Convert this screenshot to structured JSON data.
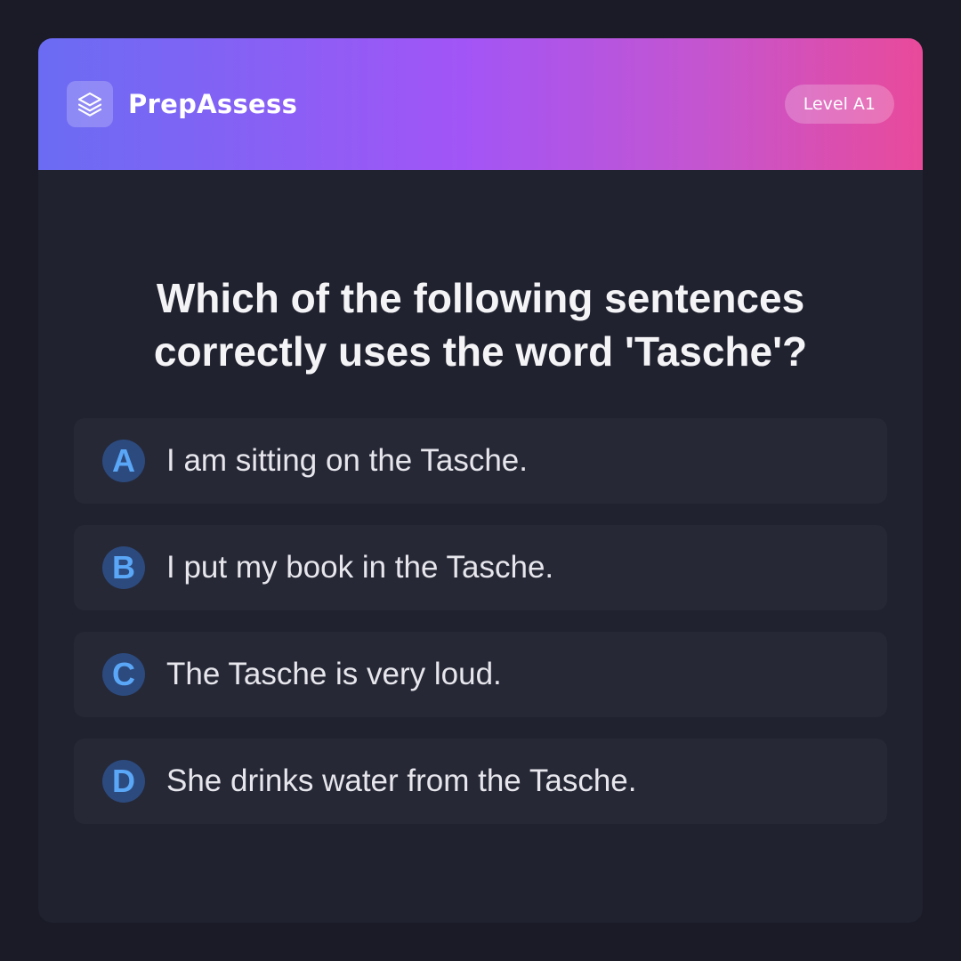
{
  "header": {
    "app_name": "PrepAssess",
    "level_badge": "Level A1",
    "logo_icon": "layers-icon"
  },
  "question": {
    "text": "Which of the following sentences correctly uses the word 'Tasche'?"
  },
  "options": [
    {
      "letter": "A",
      "text": "I am sitting on the Tasche."
    },
    {
      "letter": "B",
      "text": "I put my book in the Tasche."
    },
    {
      "letter": "C",
      "text": "The Tasche is very loud."
    },
    {
      "letter": "D",
      "text": "She drinks water from the Tasche."
    }
  ],
  "colors": {
    "background": "#1a1b26",
    "card": "#20222f",
    "option_bg": "#262836",
    "letter_bg": "#2c4a7e",
    "letter_fg": "#5aa6f7",
    "gradient_start": "#6a6cf3",
    "gradient_mid": "#a255f6",
    "gradient_end": "#e94a9a"
  }
}
